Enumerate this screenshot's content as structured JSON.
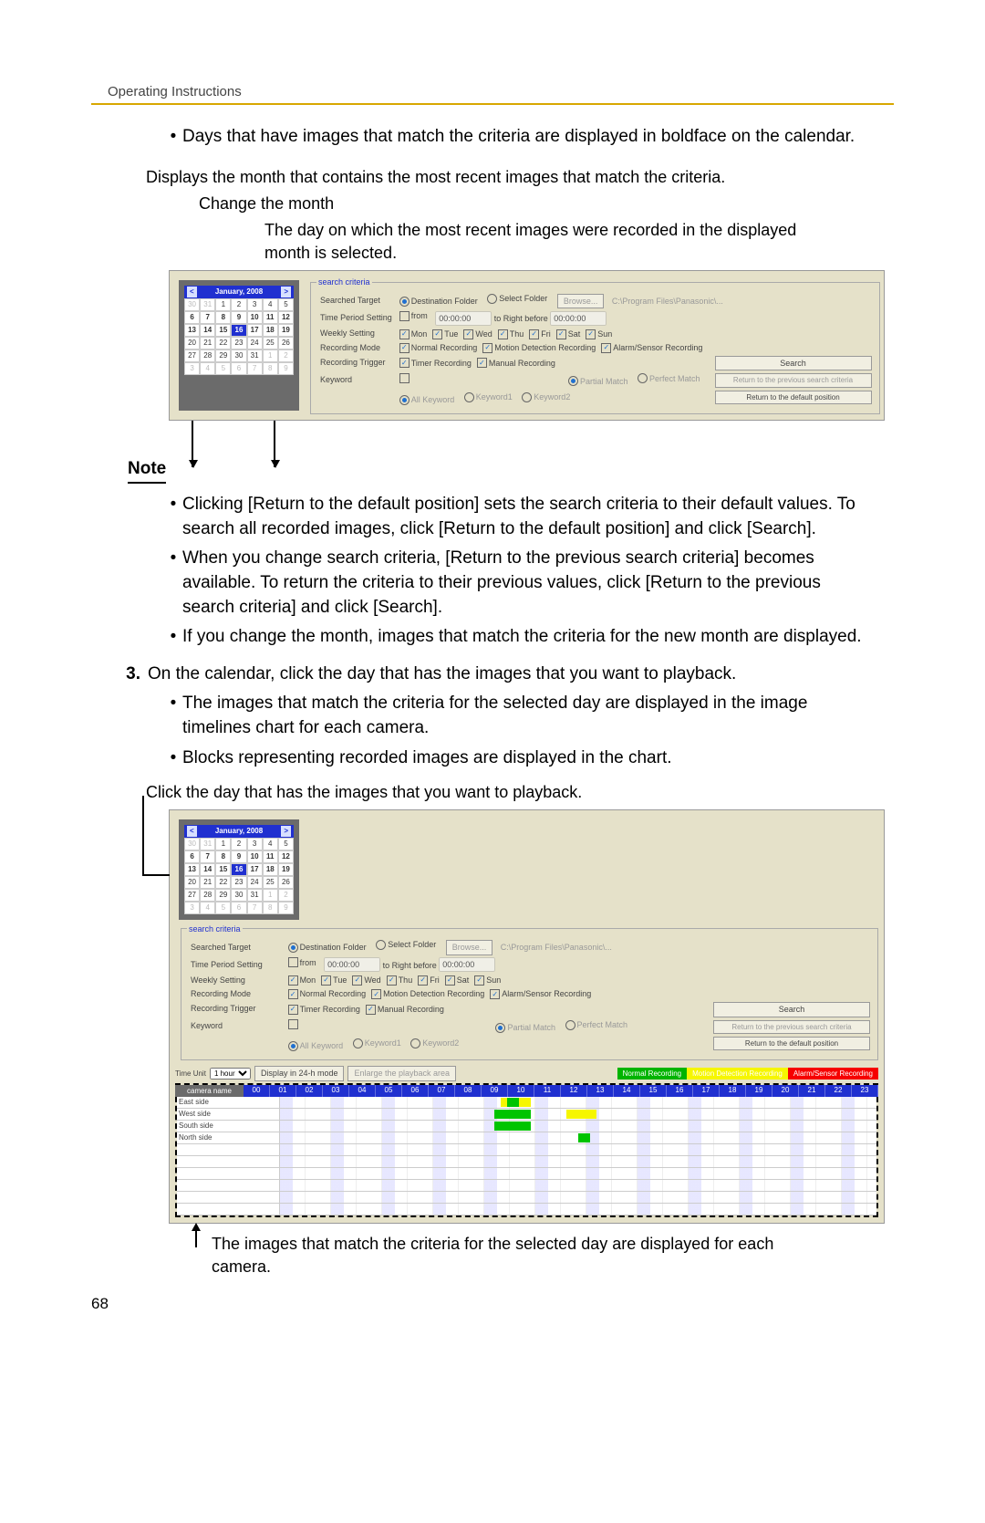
{
  "header": "Operating Instructions",
  "page_number": "68",
  "top_bullet": "Days that have images that match the criteria are displayed in boldface on the calendar.",
  "labels": {
    "displays_month": "Displays the month that contains the most recent images that match the criteria.",
    "change_month": "Change the month",
    "day_recent": "The day on which the most recent images were recorded in the displayed month is selected."
  },
  "calendar": {
    "title": "January, 2008",
    "prev": "<",
    "next": ">",
    "rows": [
      [
        "30",
        "31",
        "1",
        "2",
        "3",
        "4",
        "5"
      ],
      [
        "6",
        "7",
        "8",
        "9",
        "10",
        "11",
        "12"
      ],
      [
        "13",
        "14",
        "15",
        "16",
        "17",
        "18",
        "19"
      ],
      [
        "20",
        "21",
        "22",
        "23",
        "24",
        "25",
        "26"
      ],
      [
        "27",
        "28",
        "29",
        "30",
        "31",
        "1",
        "2"
      ],
      [
        "3",
        "4",
        "5",
        "6",
        "7",
        "8",
        "9"
      ]
    ],
    "out_month_first": [
      "30",
      "31"
    ],
    "out_month_last_row5": [
      "1",
      "2"
    ],
    "selected": "16"
  },
  "criteria": {
    "legend": "search criteria",
    "rows": {
      "target_label": "Searched Target",
      "target_opt1": "Destination Folder",
      "target_opt2": "Select Folder",
      "browse": "Browse...",
      "path": "C:\\Program Files\\Panasonic\\...",
      "period_label": "Time Period Setting",
      "from": "from",
      "time1": "00:00:00",
      "to": "to Right before",
      "time2": "00:00:00",
      "weekly_label": "Weekly Setting",
      "days": [
        "Mon",
        "Tue",
        "Wed",
        "Thu",
        "Fri",
        "Sat",
        "Sun"
      ],
      "recmode_label": "Recording Mode",
      "recmode_opts": [
        "Normal Recording",
        "Motion Detection Recording",
        "Alarm/Sensor Recording"
      ],
      "trigger_label": "Recording Trigger",
      "trigger_opts": [
        "Timer Recording",
        "Manual Recording"
      ],
      "keyword_label": "Keyword",
      "kw_radio1": "All Keyword",
      "kw_radio2": "Keyword1",
      "kw_radio3": "Keyword2",
      "match1": "Partial Match",
      "match2": "Perfect Match"
    },
    "buttons": {
      "search": "Search",
      "return_prev": "Return to the previous search criteria",
      "return_def": "Return to the default position"
    }
  },
  "note_heading": "Note",
  "note_bullets": [
    "Clicking [Return to the default position] sets the search criteria to their default values. To search all recorded images, click [Return to the default position] and click [Search].",
    "When you change search criteria, [Return to the previous search criteria] becomes available. To return the criteria to their previous values, click [Return to the previous search criteria] and click [Search].",
    "If you change the month, images that match the criteria for the new month are displayed."
  ],
  "step3": {
    "num": "3.",
    "text": "On the calendar, click the day that has the images that you want to playback.",
    "sub": [
      "The images that match the criteria for the selected day are displayed in the image timelines chart for each camera.",
      "Blocks representing recorded images are displayed in the chart."
    ]
  },
  "click_label": "Click the day that has the images that you want to playback.",
  "timeline": {
    "timeunit_label": "Time Unit",
    "timeunit_value": "1 hour",
    "btn_24h": "Display in 24-h mode",
    "btn_enlarge": "Enlarge the playback area",
    "legend_normal": "Normal Recording",
    "legend_motion": "Motion Detection Recording",
    "legend_alarm": "Alarm/Sensor Recording",
    "name_header": "camera name",
    "hours": [
      "00",
      "01",
      "02",
      "03",
      "04",
      "05",
      "06",
      "07",
      "08",
      "09",
      "10",
      "11",
      "12",
      "13",
      "14",
      "15",
      "16",
      "17",
      "18",
      "19",
      "20",
      "21",
      "22",
      "23"
    ],
    "cameras": [
      "East side",
      "West side",
      "South side",
      "North side"
    ]
  },
  "caption2": "The images that match the criteria for the selected day are displayed for each camera."
}
